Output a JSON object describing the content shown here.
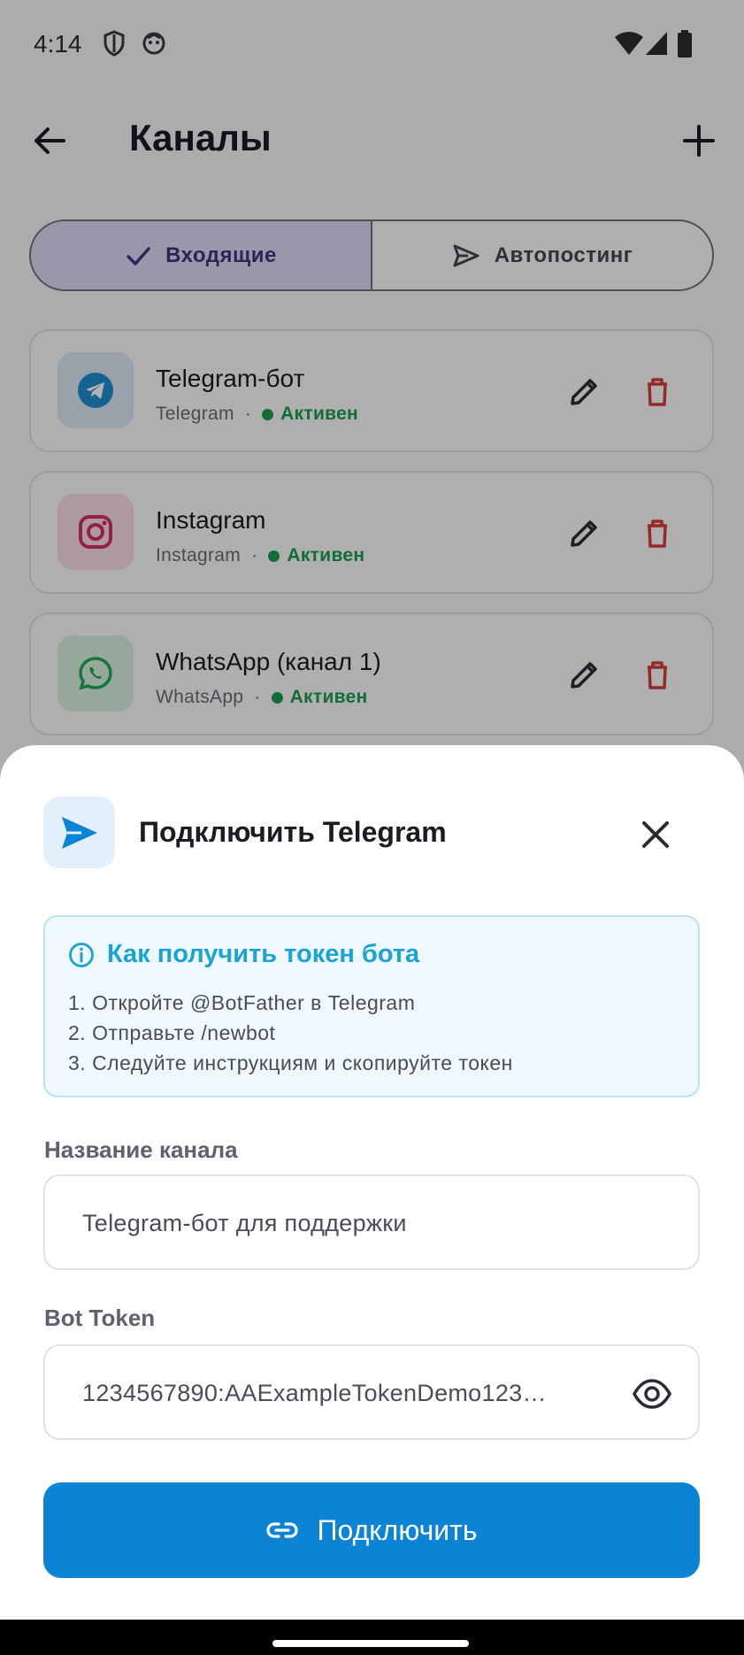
{
  "status_bar": {
    "time": "4:14"
  },
  "app_bar": {
    "title": "Каналы"
  },
  "tabs": [
    {
      "label": "Входящие",
      "icon": "check-icon",
      "active": true
    },
    {
      "label": "Автопостинг",
      "icon": "send-icon",
      "active": false
    }
  ],
  "channels": [
    {
      "name": "Telegram-бот",
      "type": "Telegram",
      "separator": "·",
      "status": "Активен",
      "icon": "telegram-icon",
      "icon_bg": "#dbe9f5"
    },
    {
      "name": "Instagram",
      "type": "Instagram",
      "separator": "·",
      "status": "Активен",
      "icon": "instagram-icon",
      "icon_bg": "#f7dde3"
    },
    {
      "name": "WhatsApp (канал 1)",
      "type": "WhatsApp",
      "separator": "·",
      "status": "Активен",
      "icon": "whatsapp-icon",
      "icon_bg": "#d9f0df"
    }
  ],
  "sheet": {
    "title": "Подключить Telegram",
    "info": {
      "title": "Как получить токен бота",
      "steps": [
        "1. Откройте @BotFather в Telegram",
        "2. Отправьте /newbot",
        "3. Следуйте инструкциям и скопируйте токен"
      ]
    },
    "channel_name": {
      "label": "Название канала",
      "value": "Telegram-бот для поддержки"
    },
    "bot_token": {
      "label": "Bot Token",
      "value": "1234567890:AAExampleTokenDemo123…"
    },
    "connect_button": "Подключить"
  },
  "colors": {
    "accent": "#0b84d6",
    "active_status": "#1a9c4e",
    "delete": "#d93a3a",
    "info": "#1aa4d4"
  }
}
